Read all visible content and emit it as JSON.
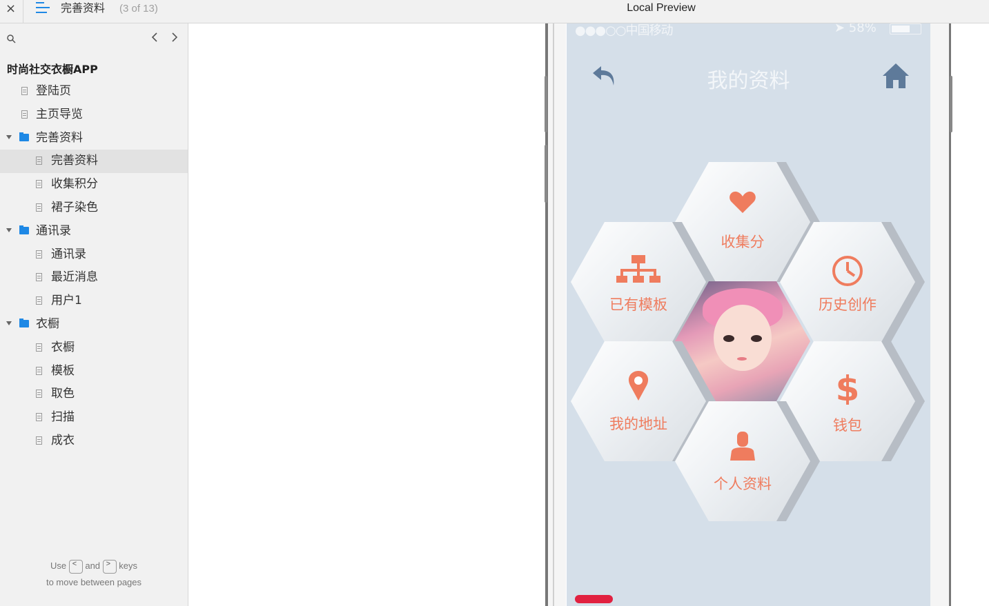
{
  "topbar": {
    "close": "×",
    "title": "完善资料",
    "count": "(3 of 13)",
    "center_title": "Local Preview"
  },
  "sidebar": {
    "project_title": "时尚社交衣橱APP",
    "items": [
      {
        "label": "登陆页"
      },
      {
        "label": "主页导览"
      },
      {
        "label": "完善资料"
      },
      {
        "label": "完善资料"
      },
      {
        "label": "收集积分"
      },
      {
        "label": "裙子染色"
      },
      {
        "label": "通讯录"
      },
      {
        "label": "通讯录"
      },
      {
        "label": "最近消息"
      },
      {
        "label": "用户1"
      },
      {
        "label": "衣橱"
      },
      {
        "label": "衣橱"
      },
      {
        "label": "模板"
      },
      {
        "label": "取色"
      },
      {
        "label": "扫描"
      },
      {
        "label": "成衣"
      }
    ],
    "hint": {
      "use": "Use",
      "key_prev": "<",
      "and": "and",
      "key_next": ">",
      "keys": "keys",
      "line2": "to move between pages"
    }
  },
  "phone": {
    "status_left": "●●●○○中国移动",
    "status_right": "➤ 58%",
    "app_title": "我的资料",
    "menu": [
      {
        "label": "收集分",
        "icon": "heart-icon"
      },
      {
        "label": "已有模板",
        "icon": "sitemap-icon"
      },
      {
        "label": "历史创作",
        "icon": "clock-icon"
      },
      {
        "label": "我的地址",
        "icon": "map-pin-icon"
      },
      {
        "label": "钱包",
        "icon": "dollar-icon"
      },
      {
        "label": "个人资料",
        "icon": "user-icon"
      }
    ],
    "accent": "#ef7c5e"
  }
}
